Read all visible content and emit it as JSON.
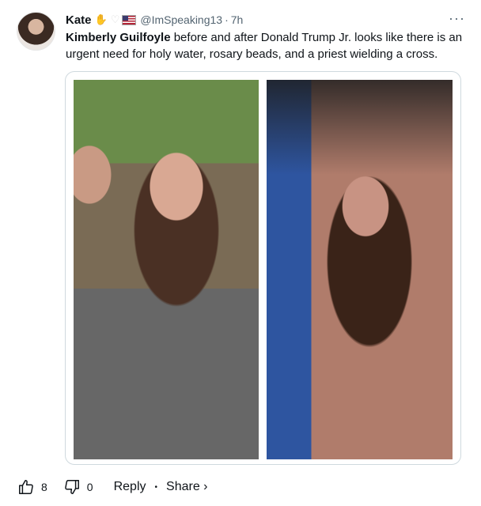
{
  "post": {
    "author_name": "Kate",
    "author_emojis": {
      "hand": "✋",
      "heart": "♡"
    },
    "handle": "@ImSpeaking13",
    "separator": "·",
    "time": "7h",
    "more_label": "···",
    "text_bold": "Kimberly Guilfoyle",
    "text_rest": " before and after Donald Trump Jr. looks like there is an urgent need for holy water, rosary beads, and a priest wielding a cross."
  },
  "actions": {
    "like_count": "8",
    "dislike_count": "0",
    "reply_label": "Reply",
    "separator": "•",
    "share_label": "Share ›"
  },
  "icons": {
    "like": "thumbs-up-icon",
    "dislike": "thumbs-down-icon",
    "more": "more-options-icon",
    "flag": "us-flag-icon"
  }
}
